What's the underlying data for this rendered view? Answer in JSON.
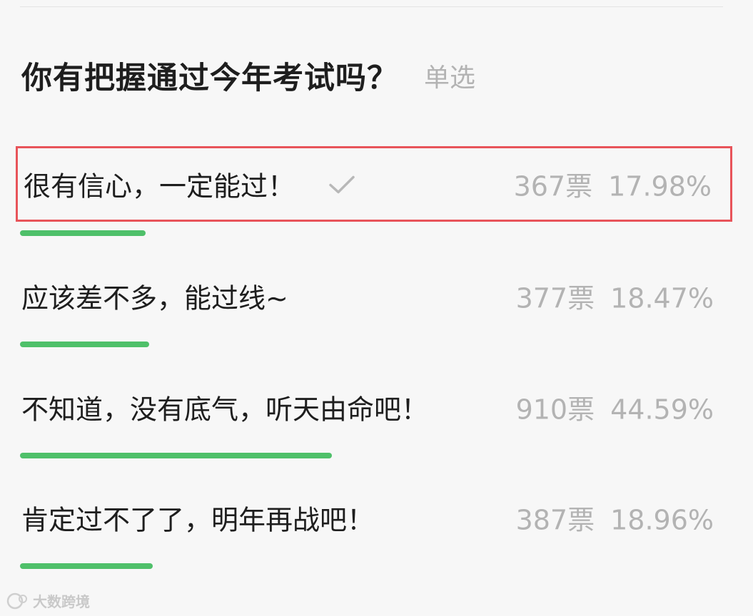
{
  "poll": {
    "question": "你有把握通过今年考试吗？",
    "type_label": "单选"
  },
  "options": [
    {
      "label": "很有信心，一定能过！",
      "votes": "367票",
      "percent": "17.98%",
      "selected": true,
      "fraction": 0.1798
    },
    {
      "label": "应该差不多，能过线~",
      "votes": "377票",
      "percent": "18.47%",
      "selected": false,
      "fraction": 0.1847
    },
    {
      "label": "不知道，没有底气，听天由命吧！",
      "votes": "910票",
      "percent": "44.59%",
      "selected": false,
      "fraction": 0.4459
    },
    {
      "label": "肯定过不了了，明年再战吧！",
      "votes": "387票",
      "percent": "18.96%",
      "selected": false,
      "fraction": 0.1896
    }
  ],
  "icons": {
    "selected_check": "check-icon"
  },
  "watermark": {
    "text": "大数跨境"
  },
  "colors": {
    "bar": "#4fc06a",
    "selected_border": "#e8545a",
    "muted_text": "#b3b3b3"
  }
}
